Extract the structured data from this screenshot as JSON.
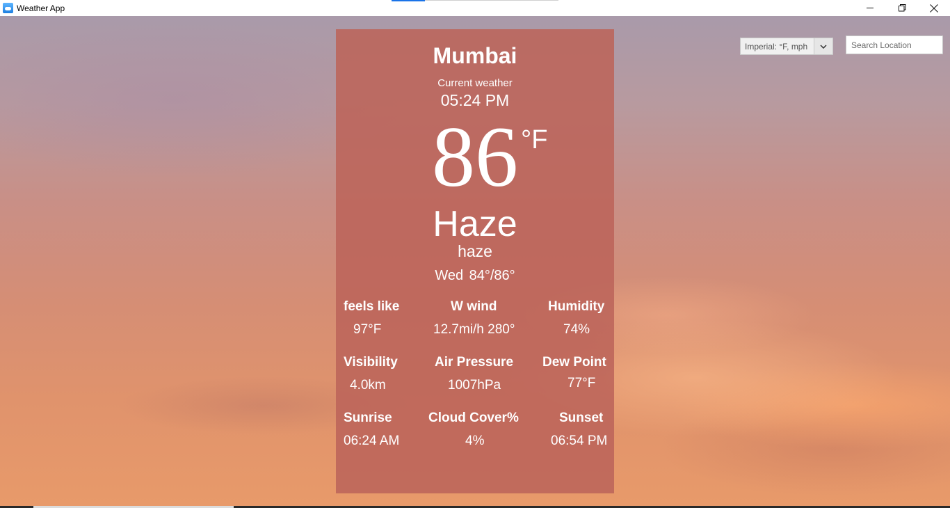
{
  "window": {
    "title": "Weather App",
    "controls": {
      "minimize_icon": "minimize-icon",
      "maximize_icon": "restore-icon",
      "close_icon": "close-icon"
    }
  },
  "toolbar": {
    "unit_select": {
      "value": "Imperial: °F, mph",
      "icon": "chevron-down-icon"
    },
    "search": {
      "placeholder": "Search Location",
      "value": ""
    }
  },
  "weather": {
    "city": "Mumbai",
    "current_label": "Current weather",
    "time": "05:24 PM",
    "temperature": "86",
    "temperature_unit": "°F",
    "condition": "Haze",
    "condition_description": "haze",
    "day_range": "Wed  84°/86°",
    "stats": {
      "feels_like": {
        "label": "feels like",
        "value": "97°F"
      },
      "wind": {
        "label": "W wind",
        "value": "12.7mi/h 280°"
      },
      "humidity": {
        "label": "Humidity",
        "value": "74%"
      },
      "visibility": {
        "label": "Visibility",
        "value": "4.0km"
      },
      "air_pressure": {
        "label": "Air Pressure",
        "value": "1007hPa"
      },
      "dew_point": {
        "label": "Dew Point",
        "value": "77°F"
      },
      "sunrise": {
        "label": "Sunrise",
        "value": "06:24 AM"
      },
      "cloud_cover": {
        "label": "Cloud Cover%",
        "value": "4%"
      },
      "sunset": {
        "label": "Sunset",
        "value": "06:54 PM"
      }
    }
  },
  "colors": {
    "card_background": "#bc645a",
    "text": "#ffffff"
  }
}
